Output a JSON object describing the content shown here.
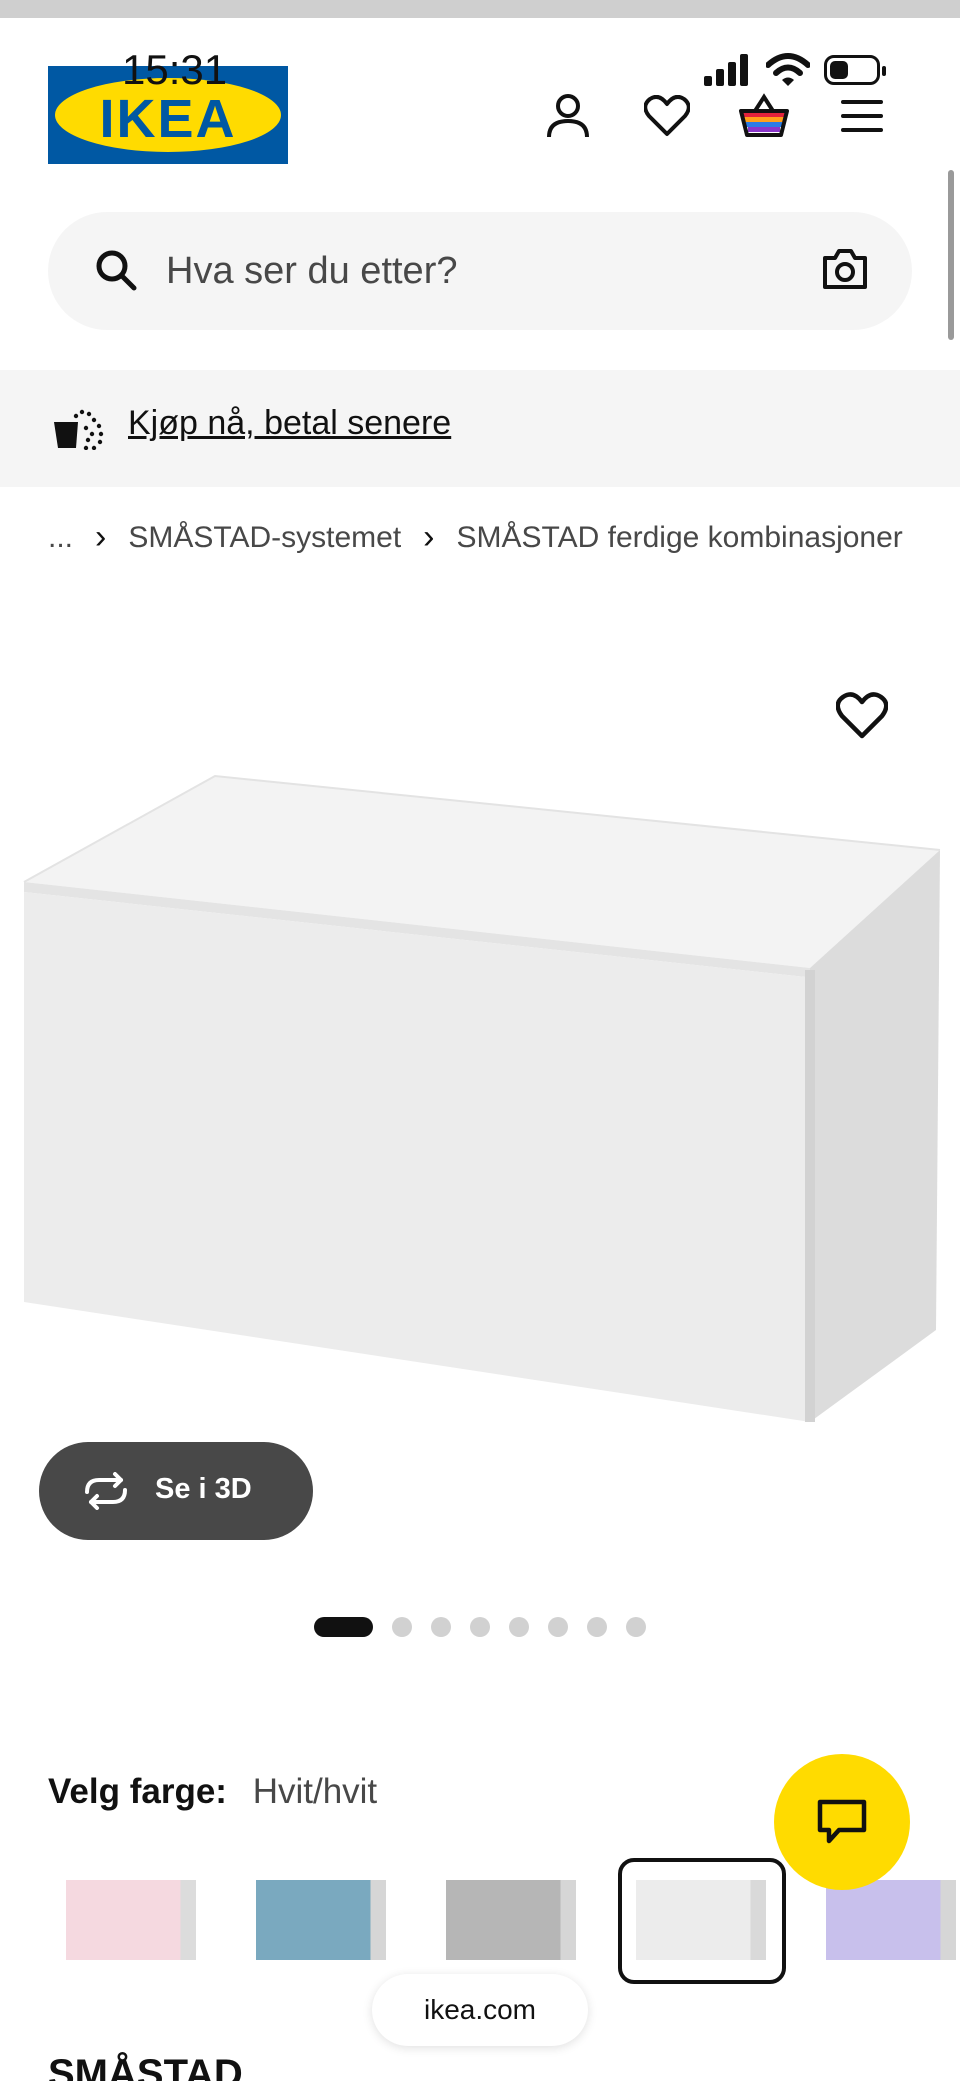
{
  "status_bar": {
    "time": "15:31"
  },
  "header": {
    "logo_text": "IKEA",
    "icons": [
      "user-icon",
      "heart-icon",
      "basket-icon",
      "menu-icon"
    ]
  },
  "search": {
    "placeholder": "Hva ser du etter?"
  },
  "promo": {
    "text": "Kjøp nå, betal senere"
  },
  "breadcrumb": {
    "items": [
      "...",
      "SMÅSTAD-systemet",
      "SMÅSTAD ferdige kombinasjoner"
    ]
  },
  "gallery": {
    "view_3d_label": "Se i 3D",
    "dot_count": 8,
    "active_index": 0
  },
  "color_picker": {
    "label": "Velg farge:",
    "selected_value": "Hvit/hvit",
    "swatch_colors": [
      "#f5d9e0",
      "#7aa9bf",
      "#b6b6b6",
      "#ececec",
      "#c8c0ec"
    ],
    "selected_index": 3
  },
  "browser": {
    "domain": "ikea.com"
  },
  "product": {
    "title_partial": "SMÅSTAD"
  },
  "colors": {
    "ikea_blue": "#0058a3",
    "ikea_yellow": "#ffdb00"
  }
}
